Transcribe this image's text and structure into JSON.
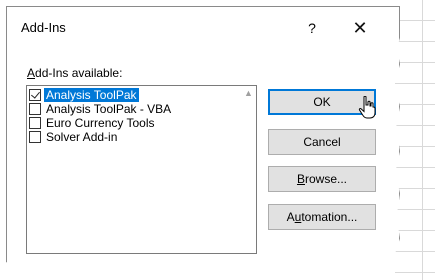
{
  "dialog": {
    "title": "Add-Ins",
    "help_label": "?",
    "close_label": "✕"
  },
  "addins_label": {
    "prefix": "A",
    "rest": "dd-Ins available:"
  },
  "addins": [
    {
      "label": "Analysis ToolPak",
      "checked": true,
      "selected": true
    },
    {
      "label": "Analysis ToolPak - VBA",
      "checked": false,
      "selected": false
    },
    {
      "label": "Euro Currency Tools",
      "checked": false,
      "selected": false
    },
    {
      "label": "Solver Add-in",
      "checked": false,
      "selected": false
    }
  ],
  "buttons": {
    "ok": "OK",
    "cancel": "Cancel",
    "browse_prefix": "B",
    "browse_rest": "rowse...",
    "automation_pre": "A",
    "automation_u": "u",
    "automation_rest": "tomation..."
  },
  "colors": {
    "selection": "#0078d7",
    "button_face": "#e1e1e1"
  }
}
